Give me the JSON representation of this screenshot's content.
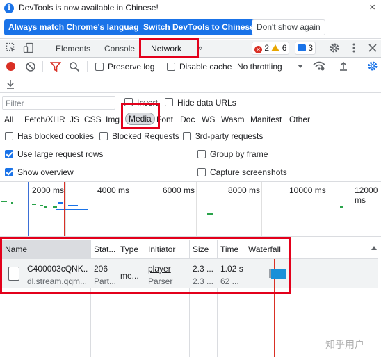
{
  "banner": {
    "message": "DevTools is now available in Chinese!",
    "info_icon": "i",
    "close": "×",
    "btn_match": "Always match Chrome's language",
    "btn_switch": "Switch DevTools to Chinese",
    "btn_dismiss": "Don't show again"
  },
  "tabs": {
    "elements": "Elements",
    "console": "Console",
    "network": "Network",
    "more": "»"
  },
  "counts": {
    "errors": "2",
    "warnings": "6",
    "messages": "3"
  },
  "toolbar": {
    "preserve_log": "Preserve log",
    "disable_cache": "Disable cache",
    "throttling": "No throttling"
  },
  "filter": {
    "placeholder": "Filter",
    "invert": "Invert",
    "hide_data_urls": "Hide data URLs",
    "types": [
      "All",
      "Fetch/XHR",
      "JS",
      "CSS",
      "Img",
      "Media",
      "Font",
      "Doc",
      "WS",
      "Wasm",
      "Manifest",
      "Other"
    ],
    "has_blocked_cookies": "Has blocked cookies",
    "blocked_requests": "Blocked Requests",
    "third_party": "3rd-party requests"
  },
  "options": {
    "large_rows": "Use large request rows",
    "group_by_frame": "Group by frame",
    "show_overview": "Show overview",
    "capture_screenshots": "Capture screenshots"
  },
  "overview": {
    "ticks": [
      "2000 ms",
      "4000 ms",
      "6000 ms",
      "8000 ms",
      "10000 ms",
      "12000 ms"
    ]
  },
  "table": {
    "headers": {
      "name": "Name",
      "status": "Stat...",
      "type": "Type",
      "initiator": "Initiator",
      "size": "Size",
      "time": "Time",
      "waterfall": "Waterfall"
    },
    "row": {
      "name": "C400003cQNK...",
      "domain": "dl.stream.qqm...",
      "status": "206",
      "status_sub": "Part...",
      "type": "me...",
      "initiator": "player",
      "initiator_sub": "Parser",
      "size": "2.3 ...",
      "size_sub": "2.3 ...",
      "time": "1.02 s",
      "time_sub": "62 ..."
    }
  },
  "watermark": "知乎用户",
  "colors": {
    "accent": "#1a73e8",
    "highlight": "#e3001b",
    "error": "#d93025",
    "warning": "#e8a600"
  }
}
